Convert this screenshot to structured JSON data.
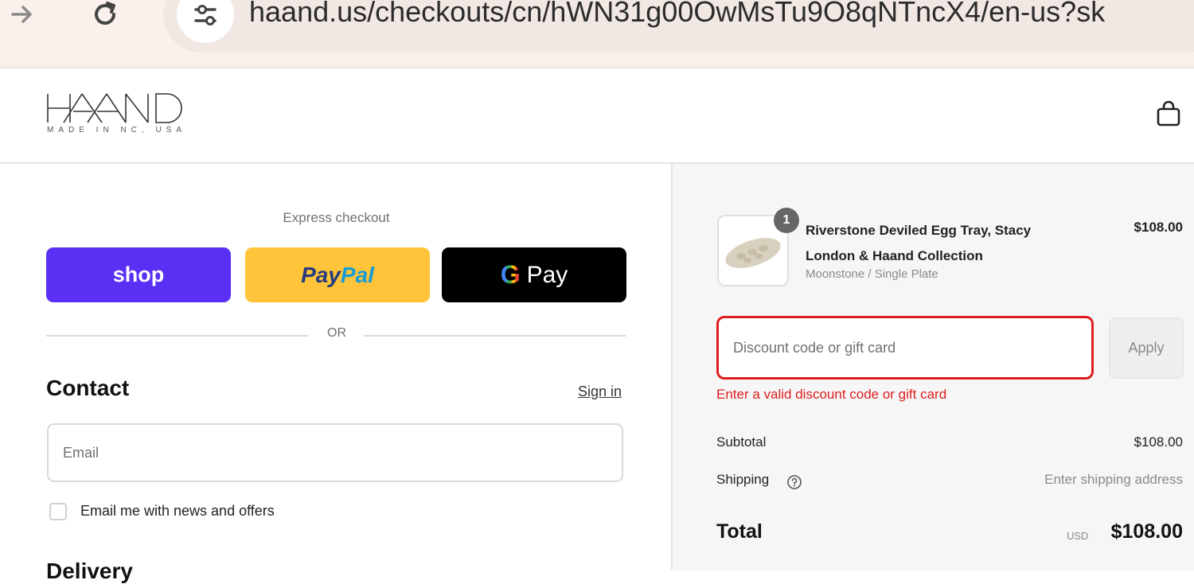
{
  "browser": {
    "url": "haand.us/checkouts/cn/hWN31g00OwMsTu9O8qNTncX4/en-us?sk"
  },
  "header": {
    "logo_text": "HAAND",
    "logo_subtitle": "MADE IN NC, USA"
  },
  "checkout": {
    "express_label": "Express checkout",
    "shop_label": "shop",
    "paypal_pay": "Pay",
    "paypal_pal": "Pal",
    "gpay_g": "G",
    "gpay_label": "Pay",
    "or_label": "OR",
    "contact_title": "Contact",
    "signin_label": "Sign in",
    "email_placeholder": "Email",
    "newsletter_label": "Email me with news and offers",
    "delivery_title": "Delivery"
  },
  "summary": {
    "item": {
      "quantity": "1",
      "name": "Riverstone Deviled Egg Tray, Stacy London & Haand Collection",
      "variant": "Moonstone / Single Plate",
      "price": "$108.00"
    },
    "discount_placeholder": "Discount code or gift card",
    "apply_label": "Apply",
    "discount_error": "Enter a valid discount code or gift card",
    "subtotal_label": "Subtotal",
    "subtotal_value": "$108.00",
    "shipping_label": "Shipping",
    "shipping_value": "Enter shipping address",
    "total_label": "Total",
    "currency": "USD",
    "total_value": "$108.00"
  },
  "colors": {
    "shop": "#5a31f4",
    "paypal": "#ffc439",
    "error": "#dd1d1d"
  }
}
